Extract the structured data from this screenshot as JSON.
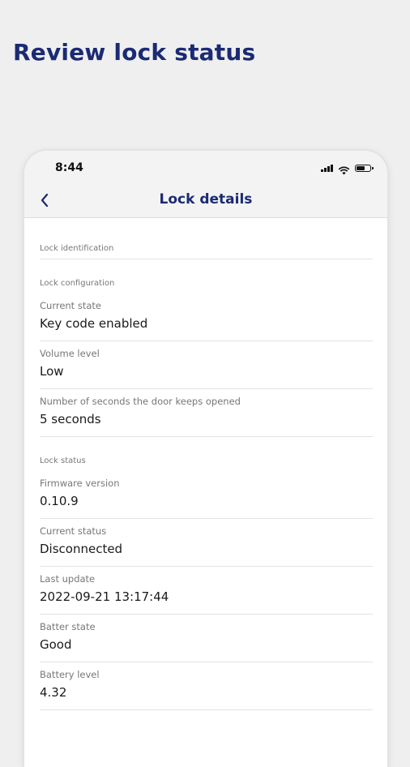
{
  "promo": {
    "title": "Review lock status"
  },
  "status_bar": {
    "time": "8:44"
  },
  "nav": {
    "title": "Lock details"
  },
  "sections": {
    "identification": {
      "header": "Lock identification"
    },
    "configuration": {
      "header": "Lock configuration",
      "fields": [
        {
          "label": "Current state",
          "value": "Key code enabled"
        },
        {
          "label": "Volume level",
          "value": "Low"
        },
        {
          "label": "Number of seconds the door keeps opened",
          "value": "5 seconds"
        }
      ]
    },
    "status": {
      "header": "Lock status",
      "fields": [
        {
          "label": "Firmware version",
          "value": "0.10.9"
        },
        {
          "label": "Current status",
          "value": "Disconnected"
        },
        {
          "label": "Last update",
          "value": "2022-09-21 13:17:44"
        },
        {
          "label": "Batter state",
          "value": "Good"
        },
        {
          "label": "Battery level",
          "value": "4.32"
        }
      ]
    }
  },
  "icons": {
    "back": "chevron-left-icon",
    "signal": "cellular-signal-icon",
    "wifi": "wifi-icon",
    "battery": "battery-icon"
  },
  "colors": {
    "brand": "#1b2a73",
    "background": "#efefef",
    "bar": "#f3f3f3"
  }
}
